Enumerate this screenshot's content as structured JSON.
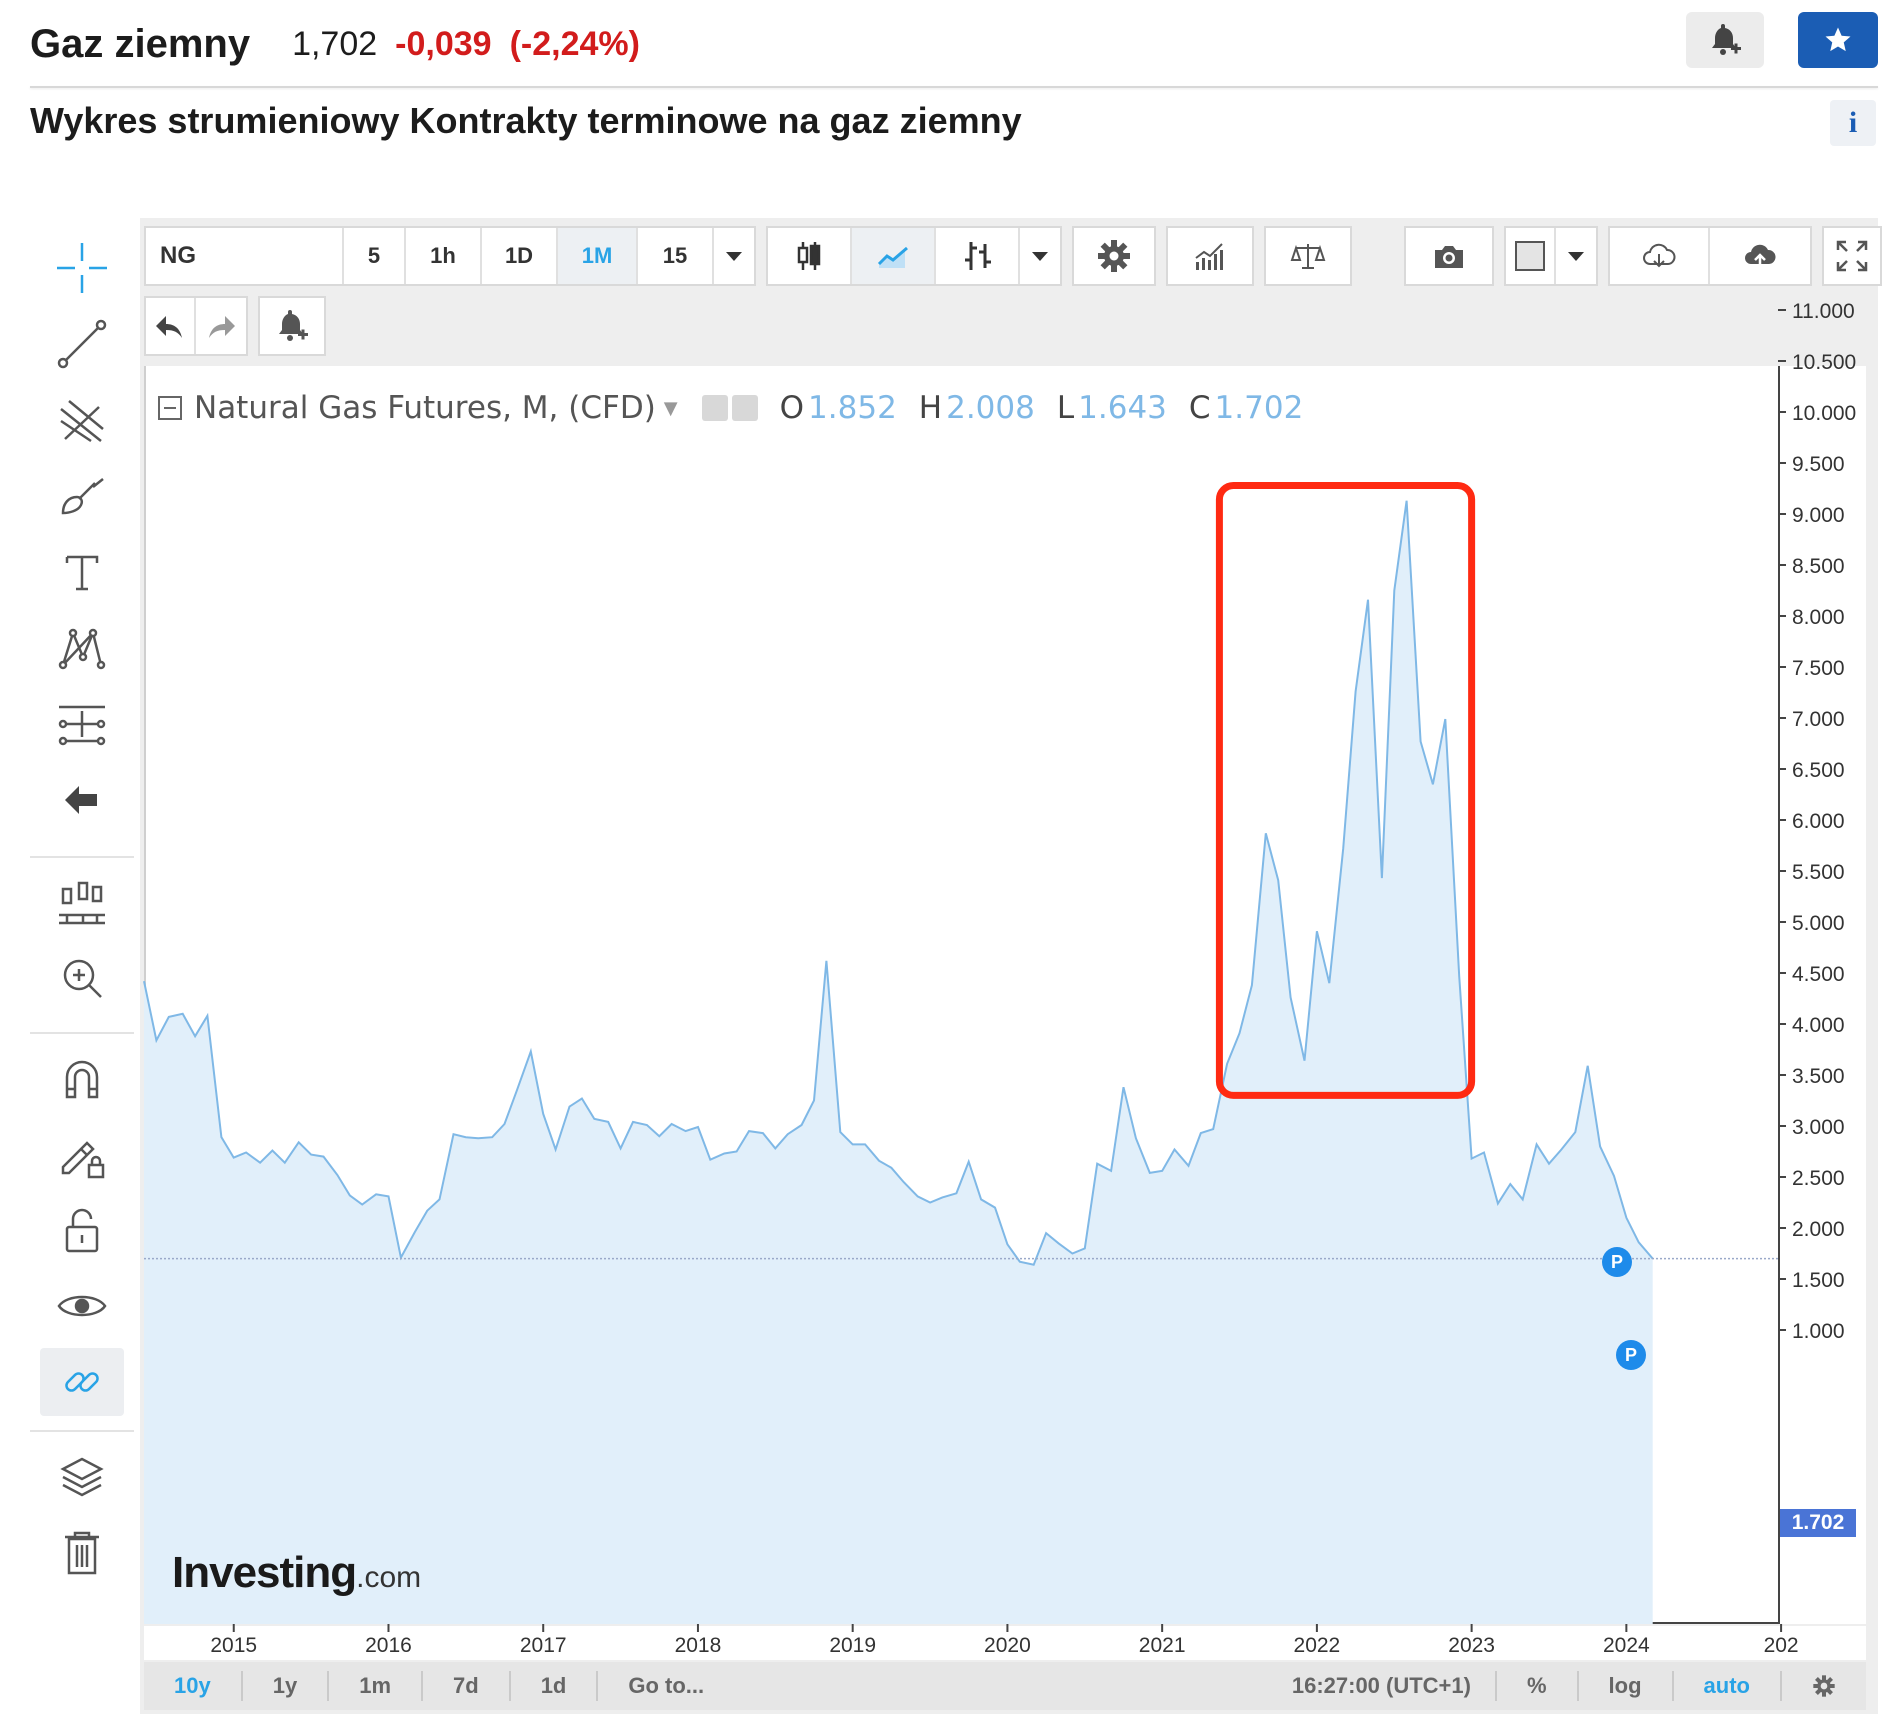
{
  "header": {
    "name": "Gaz ziemny",
    "price": "1,702",
    "change": "-0,039",
    "change_pct": "(-2,24%)"
  },
  "subtitle": "Wykres strumieniowy Kontrakty terminowe na gaz ziemny",
  "info_label": "i",
  "toolbar": {
    "symbol": "NG",
    "intervals": [
      "5",
      "1h",
      "1D",
      "1M",
      "15"
    ],
    "active_interval": "1M"
  },
  "legend": {
    "title": "Natural Gas Futures, M, (CFD)",
    "o_label": "O",
    "o_value": "1.852",
    "h_label": "H",
    "h_value": "2.008",
    "l_label": "L",
    "l_value": "1.643",
    "c_label": "C",
    "c_value": "1.702"
  },
  "logo": {
    "main": "Investing",
    "suffix": ".com"
  },
  "current_price_tag": "1.702",
  "markers": {
    "p1": "P",
    "p2": "P"
  },
  "bottom_bar": {
    "ranges": [
      "10y",
      "1y",
      "1m",
      "7d",
      "1d"
    ],
    "active_range": "10y",
    "goto": "Go to...",
    "time": "16:27:00 (UTC+1)",
    "percent": "%",
    "log": "log",
    "auto": "auto"
  },
  "colors": {
    "accent": "#29a3e6",
    "series_line": "#7fb8e6",
    "series_fill": "#e1effa",
    "highlight_box": "#ff2a12",
    "negative": "#d21c1c",
    "brand_button": "#1b5db4"
  },
  "chart_data": {
    "type": "area",
    "title": "Natural Gas Futures, M, (CFD)",
    "xlabel": "",
    "ylabel": "",
    "x_tick_labels": [
      "2015",
      "2016",
      "2017",
      "2018",
      "2019",
      "2020",
      "2021",
      "2022",
      "2023",
      "2024",
      "202"
    ],
    "y_tick_labels": [
      "11.000",
      "10.500",
      "10.000",
      "9.500",
      "9.000",
      "8.500",
      "8.000",
      "7.500",
      "7.000",
      "6.500",
      "6.000",
      "5.500",
      "5.000",
      "4.500",
      "4.000",
      "3.500",
      "3.000",
      "2.500",
      "2.000",
      "1.500",
      "1.000"
    ],
    "ylim": [
      0.9,
      11.0
    ],
    "xlim": [
      2014.42,
      2024.98
    ],
    "grid": false,
    "series": [
      {
        "x": [
          2014.42,
          2014.5,
          2014.58,
          2014.67,
          2014.75,
          2014.83,
          2014.92,
          2015.0,
          2015.08,
          2015.17,
          2015.25,
          2015.33,
          2015.42,
          2015.5,
          2015.58,
          2015.67,
          2015.75,
          2015.83,
          2015.92,
          2016.0,
          2016.08,
          2016.17,
          2016.25,
          2016.33,
          2016.42,
          2016.5,
          2016.58,
          2016.67,
          2016.75,
          2016.83,
          2016.92,
          2017.0,
          2017.08,
          2017.17,
          2017.25,
          2017.33,
          2017.42,
          2017.5,
          2017.58,
          2017.67,
          2017.75,
          2017.83,
          2017.92,
          2018.0,
          2018.08,
          2018.17,
          2018.25,
          2018.33,
          2018.42,
          2018.5,
          2018.58,
          2018.67,
          2018.75,
          2018.83,
          2018.92,
          2019.0,
          2019.08,
          2019.17,
          2019.25,
          2019.33,
          2019.42,
          2019.5,
          2019.58,
          2019.67,
          2019.75,
          2019.83,
          2019.92,
          2020.0,
          2020.08,
          2020.17,
          2020.25,
          2020.33,
          2020.42,
          2020.5,
          2020.58,
          2020.67,
          2020.75,
          2020.83,
          2020.92,
          2021.0,
          2021.08,
          2021.17,
          2021.25,
          2021.33,
          2021.42,
          2021.5,
          2021.58,
          2021.67,
          2021.75,
          2021.83,
          2021.92,
          2022.0,
          2022.08,
          2022.17,
          2022.25,
          2022.33,
          2022.42,
          2022.5,
          2022.58,
          2022.67,
          2022.75,
          2022.83,
          2022.92,
          2023.0,
          2023.08,
          2023.17,
          2023.25,
          2023.33,
          2023.42,
          2023.5,
          2023.58,
          2023.67,
          2023.75,
          2023.83,
          2023.92,
          2024.0,
          2024.08,
          2024.17
        ],
        "y": [
          4.42,
          3.84,
          4.07,
          4.1,
          3.88,
          4.08,
          2.89,
          2.69,
          2.74,
          2.64,
          2.76,
          2.64,
          2.84,
          2.72,
          2.7,
          2.52,
          2.32,
          2.23,
          2.33,
          2.31,
          1.71,
          1.96,
          2.17,
          2.28,
          2.92,
          2.89,
          2.88,
          2.89,
          3.02,
          3.35,
          3.73,
          3.12,
          2.77,
          3.19,
          3.27,
          3.07,
          3.04,
          2.78,
          3.04,
          3.01,
          2.9,
          3.02,
          2.95,
          2.99,
          2.67,
          2.73,
          2.75,
          2.95,
          2.93,
          2.78,
          2.92,
          3.01,
          3.25,
          4.62,
          2.94,
          2.82,
          2.82,
          2.66,
          2.59,
          2.45,
          2.31,
          2.25,
          2.3,
          2.34,
          2.65,
          2.28,
          2.2,
          1.84,
          1.67,
          1.64,
          1.95,
          1.85,
          1.75,
          1.8,
          2.63,
          2.56,
          3.38,
          2.88,
          2.54,
          2.56,
          2.77,
          2.61,
          2.93,
          2.97,
          3.61,
          3.91,
          4.38,
          5.87,
          5.41,
          4.26,
          3.64,
          4.91,
          4.4,
          5.72,
          7.26,
          8.16,
          5.43,
          8.25,
          9.13,
          6.77,
          6.35,
          6.99,
          4.47,
          2.68,
          2.74,
          2.24,
          2.43,
          2.28,
          2.82,
          2.63,
          2.77,
          2.94,
          3.59,
          2.8,
          2.51,
          2.1,
          1.86,
          1.7
        ]
      }
    ],
    "annotations": [
      "current price 1.702",
      "P",
      "P",
      "red highlight box 2021.4-2023.0"
    ]
  }
}
